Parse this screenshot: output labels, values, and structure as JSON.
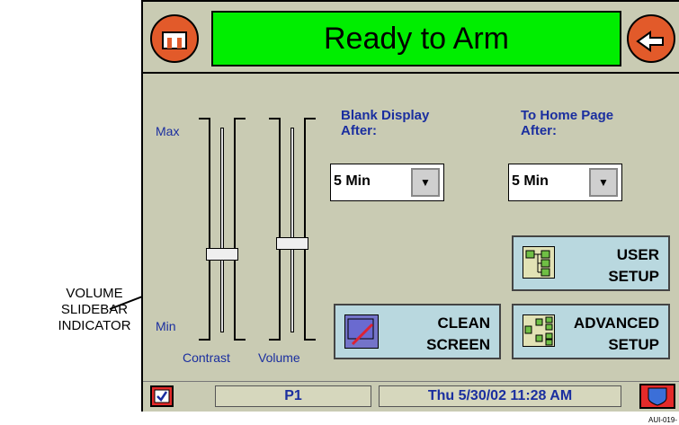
{
  "header": {
    "title": "Ready to Arm",
    "left_icon": "home-icon",
    "right_icon": "back-arrow-icon"
  },
  "sliders": {
    "max_label": "Max",
    "min_label": "Min",
    "contrast_label": "Contrast",
    "volume_label": "Volume",
    "contrast_level": 0.45,
    "volume_level": 0.5
  },
  "blank_display": {
    "label_line1": "Blank Display",
    "label_line2": "After:",
    "value": "5 Min"
  },
  "home_page": {
    "label_line1": "To Home Page",
    "label_line2": "After:",
    "value": "5 Min"
  },
  "buttons": {
    "user_setup_line1": "USER",
    "user_setup_line2": "SETUP",
    "clean_screen_line1": "CLEAN",
    "clean_screen_line2": "SCREEN",
    "advanced_setup_line1": "ADVANCED",
    "advanced_setup_line2": "SETUP"
  },
  "status": {
    "partition": "P1",
    "datetime": "Thu 5/30/02 11:28 AM",
    "left_icon": "checkbox-icon",
    "right_icon": "shield-icon"
  },
  "annotation": {
    "line1": "VOLUME",
    "line2": "SLIDEBAR",
    "line3": "INDICATOR"
  },
  "figure_id": "AUI-019-"
}
